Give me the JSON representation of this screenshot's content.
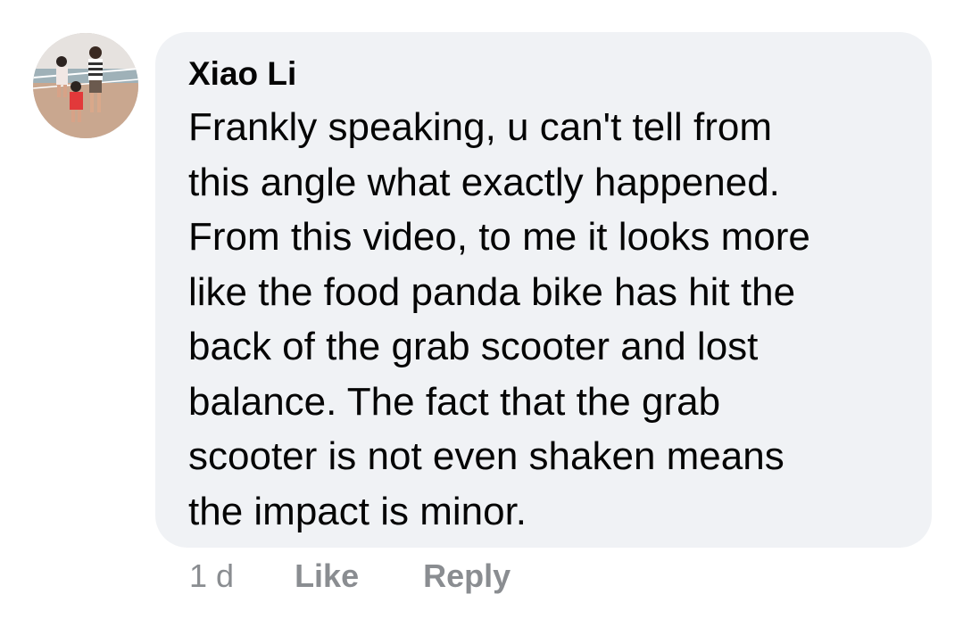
{
  "comment": {
    "author": "Xiao Li",
    "lines": [
      "Frankly speaking, u can't tell from",
      "this angle what exactly happened.",
      "From this video, to me it looks more",
      "like the food panda bike has hit the",
      "back of the grab scooter and lost",
      "balance. The fact that the grab",
      "scooter is not even shaken means",
      "the impact is minor."
    ],
    "avatar_icon": "profile-photo",
    "bubble_color": "#f0f2f5"
  },
  "actions": {
    "time": "1 d",
    "like": "Like",
    "reply": "Reply"
  }
}
